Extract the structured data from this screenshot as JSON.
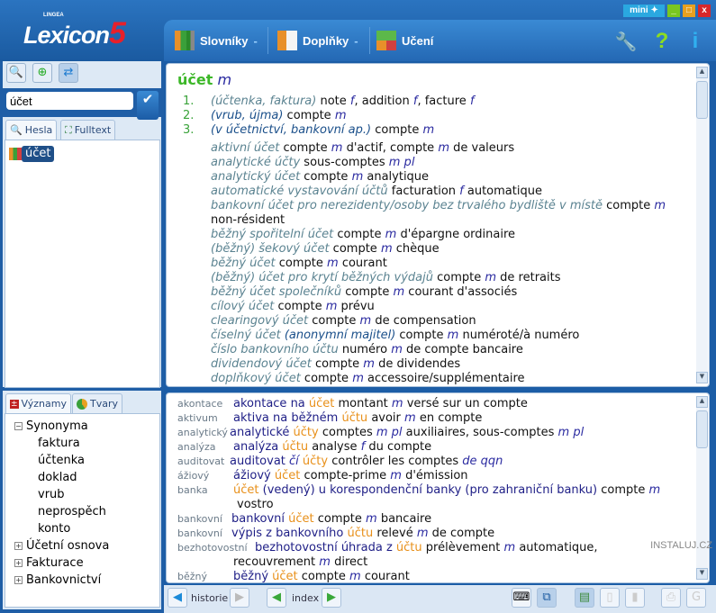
{
  "app": {
    "logo": "Lexicon",
    "logo_number": "5",
    "logo_brand": "LINGEA",
    "watermark": "INSTALUJ.CZ"
  },
  "window": {
    "mini": "mini ✦",
    "minimize": "_",
    "maximize": "□",
    "close": "x"
  },
  "nav": {
    "items": [
      {
        "label": "Slovníky",
        "icon": "books-icon",
        "dropdown": true
      },
      {
        "label": "Doplňky",
        "icon": "notebooks-icon",
        "dropdown": true
      },
      {
        "label": "Učení",
        "icon": "abc-blocks-icon"
      }
    ],
    "tools": [
      {
        "icon": "wrench-icon",
        "glyph": "🔧"
      },
      {
        "icon": "help-icon",
        "glyph": "?"
      },
      {
        "icon": "info-icon",
        "glyph": "i"
      }
    ]
  },
  "left": {
    "search_value": "účet",
    "tabs": [
      {
        "label": "Hesla",
        "icon": "magnifier-icon",
        "active": true
      },
      {
        "label": "Fulltext",
        "icon": "binoculars-icon"
      }
    ],
    "hits": [
      "účet"
    ],
    "lower_tabs": [
      {
        "label": "Významy",
        "icon": "plus-minus-icon",
        "active": true
      },
      {
        "label": "Tvary",
        "icon": "pie-icon"
      }
    ],
    "tree": [
      {
        "label": "Synonyma",
        "expanded": true,
        "children": [
          "faktura",
          "účtenka",
          "doklad",
          "vrub",
          "neprospěch",
          "konto"
        ]
      },
      {
        "label": "Účetní osnova",
        "expanded": false
      },
      {
        "label": "Fakturace",
        "expanded": false
      },
      {
        "label": "Bankovnictví",
        "expanded": false
      }
    ]
  },
  "entry": {
    "headword": "účet",
    "gender": "m",
    "senses": [
      {
        "num": "1.",
        "parts": [
          [
            "cz",
            "(účtenka, faktura)"
          ],
          [
            "fr",
            " note "
          ],
          [
            "g",
            "f"
          ],
          [
            "fr",
            ", addition "
          ],
          [
            "g",
            "f"
          ],
          [
            "fr",
            ", facture "
          ],
          [
            "g",
            "f"
          ]
        ]
      },
      {
        "num": "2.",
        "parts": [
          [
            "czn",
            "(vrub, újma)"
          ],
          [
            "fr",
            " compte "
          ],
          [
            "g",
            "m"
          ]
        ]
      },
      {
        "num": "3.",
        "parts": [
          [
            "czn",
            "(v účetnictví, bankovní ap.)"
          ],
          [
            "fr",
            " compte "
          ],
          [
            "g",
            "m"
          ]
        ]
      }
    ],
    "phrases": [
      [
        [
          "cz",
          "aktivní účet"
        ],
        [
          "fr",
          "  compte "
        ],
        [
          "g",
          "m"
        ],
        [
          "fr",
          " d'actif, compte "
        ],
        [
          "g",
          "m"
        ],
        [
          "fr",
          " de valeurs"
        ]
      ],
      [
        [
          "cz",
          "analytické účty"
        ],
        [
          "fr",
          "  sous-comptes "
        ],
        [
          "g",
          "m pl"
        ]
      ],
      [
        [
          "cz",
          "analytický účet"
        ],
        [
          "fr",
          "  compte "
        ],
        [
          "g",
          "m"
        ],
        [
          "fr",
          " analytique"
        ]
      ],
      [
        [
          "cz",
          "automatické vystavování účtů"
        ],
        [
          "fr",
          "  facturation "
        ],
        [
          "g",
          "f"
        ],
        [
          "fr",
          " automatique"
        ]
      ],
      [
        [
          "cz",
          "bankovní účet pro nerezidenty/osoby bez trvalého bydliště v místě"
        ],
        [
          "fr",
          "  compte "
        ],
        [
          "g",
          "m"
        ]
      ],
      [
        [
          "fr",
          " non-résident"
        ]
      ],
      [
        [
          "cz",
          "běžný spořitelní účet"
        ],
        [
          "fr",
          "  compte "
        ],
        [
          "g",
          "m"
        ],
        [
          "fr",
          " d'épargne ordinaire"
        ]
      ],
      [
        [
          "cz",
          "(běžný) šekový účet"
        ],
        [
          "fr",
          "  compte "
        ],
        [
          "g",
          "m"
        ],
        [
          "fr",
          " chèque"
        ]
      ],
      [
        [
          "cz",
          "běžný účet"
        ],
        [
          "fr",
          "  compte "
        ],
        [
          "g",
          "m"
        ],
        [
          "fr",
          " courant"
        ]
      ],
      [
        [
          "cz",
          "(běžný) účet pro krytí běžných výdajů"
        ],
        [
          "fr",
          "  compte "
        ],
        [
          "g",
          "m"
        ],
        [
          "fr",
          " de retraits"
        ]
      ],
      [
        [
          "cz",
          "běžný účet společníků"
        ],
        [
          "fr",
          "  compte "
        ],
        [
          "g",
          "m"
        ],
        [
          "fr",
          " courant d'associés"
        ]
      ],
      [
        [
          "cz",
          "cílový účet"
        ],
        [
          "fr",
          "  compte "
        ],
        [
          "g",
          "m"
        ],
        [
          "fr",
          " prévu"
        ]
      ],
      [
        [
          "cz",
          "clearingový účet"
        ],
        [
          "fr",
          "  compte "
        ],
        [
          "g",
          "m"
        ],
        [
          "fr",
          " de compensation"
        ]
      ],
      [
        [
          "cz",
          "číselný účet "
        ],
        [
          "czn",
          "(anonymní majitel)"
        ],
        [
          "fr",
          "  compte "
        ],
        [
          "g",
          "m"
        ],
        [
          "fr",
          " numéroté/à numéro"
        ]
      ],
      [
        [
          "cz",
          "číslo bankovního účtu"
        ],
        [
          "fr",
          "  numéro "
        ],
        [
          "g",
          "m"
        ],
        [
          "fr",
          " de compte bancaire"
        ]
      ],
      [
        [
          "cz",
          "dividendový účet"
        ],
        [
          "fr",
          "  compte "
        ],
        [
          "g",
          "m"
        ],
        [
          "fr",
          " de dividendes"
        ]
      ],
      [
        [
          "cz",
          "doplňkový účet"
        ],
        [
          "fr",
          "  compte "
        ],
        [
          "g",
          "m"
        ],
        [
          "fr",
          " accessoire/supplémentaire"
        ]
      ]
    ]
  },
  "fulltext": [
    {
      "key": "akontace",
      "parts": [
        [
          "cn",
          "akontace na "
        ],
        [
          "hl",
          "účet"
        ],
        [
          "fr",
          "  montant "
        ],
        [
          "g",
          "m"
        ],
        [
          "fr",
          " versé sur un compte"
        ]
      ]
    },
    {
      "key": "aktivum",
      "parts": [
        [
          "cn",
          "aktiva na běžném "
        ],
        [
          "hl",
          "účtu"
        ],
        [
          "fr",
          "  avoir "
        ],
        [
          "g",
          "m"
        ],
        [
          "fr",
          " en compte"
        ]
      ]
    },
    {
      "key": "analytický",
      "parts": [
        [
          "cn",
          "analytické "
        ],
        [
          "hl",
          "účty"
        ],
        [
          "fr",
          "  comptes "
        ],
        [
          "g",
          "m pl"
        ],
        [
          "fr",
          " auxiliaires, sous-comptes "
        ],
        [
          "g",
          "m pl"
        ]
      ]
    },
    {
      "key": "analýza",
      "parts": [
        [
          "cn",
          "analýza "
        ],
        [
          "hl",
          "účtu"
        ],
        [
          "fr",
          "  analyse "
        ],
        [
          "g",
          "f"
        ],
        [
          "fr",
          " du compte"
        ]
      ]
    },
    {
      "key": "auditovat",
      "parts": [
        [
          "cn",
          "auditovat "
        ],
        [
          "g",
          "čí"
        ],
        [
          "hl",
          " účty"
        ],
        [
          "fr",
          "  contrôler les comptes "
        ],
        [
          "g",
          "de qqn"
        ]
      ]
    },
    {
      "key": "ážiový",
      "parts": [
        [
          "cn",
          "ážiový "
        ],
        [
          "hl",
          "účet"
        ],
        [
          "fr",
          "  compte-prime "
        ],
        [
          "g",
          "m"
        ],
        [
          "fr",
          " d'émission"
        ]
      ]
    },
    {
      "key": "banka",
      "parts": [
        [
          "hl",
          "účet"
        ],
        [
          "cn",
          " (vedený) u korespondenční banky (pro zahraniční banku)"
        ],
        [
          "fr",
          "  compte "
        ],
        [
          "g",
          "m"
        ]
      ]
    },
    {
      "key": "",
      "parts": [
        [
          "fr",
          " vostro"
        ]
      ]
    },
    {
      "key": "bankovní",
      "parts": [
        [
          "cn",
          "bankovní "
        ],
        [
          "hl",
          "účet"
        ],
        [
          "fr",
          "  compte "
        ],
        [
          "g",
          "m"
        ],
        [
          "fr",
          " bancaire"
        ]
      ]
    },
    {
      "key": "bankovní",
      "parts": [
        [
          "cn",
          "výpis z bankovního "
        ],
        [
          "hl",
          "účtu"
        ],
        [
          "fr",
          "  relevé "
        ],
        [
          "g",
          "m"
        ],
        [
          "fr",
          " de compte"
        ]
      ]
    },
    {
      "key": "bezhotovostní",
      "parts": [
        [
          "cn",
          "bezhotovostní úhrada z "
        ],
        [
          "hl",
          "účtu"
        ],
        [
          "fr",
          "  prélèvement "
        ],
        [
          "g",
          "m"
        ],
        [
          "fr",
          " automatique,"
        ]
      ]
    },
    {
      "key": "",
      "parts": [
        [
          "fr",
          "recouvrement "
        ],
        [
          "g",
          "m"
        ],
        [
          "fr",
          " direct"
        ]
      ]
    },
    {
      "key": "běžný",
      "parts": [
        [
          "cn",
          "běžný "
        ],
        [
          "hl",
          "účet"
        ],
        [
          "fr",
          "  compte "
        ],
        [
          "g",
          "m"
        ],
        [
          "fr",
          " courant"
        ]
      ]
    }
  ],
  "footer": {
    "history_label": "historie",
    "index_label": "index"
  },
  "colors": {
    "header": "#1c5da6",
    "headword": "#3cb728",
    "highlight": "#e8901a",
    "gender": "#2a2aa0"
  }
}
